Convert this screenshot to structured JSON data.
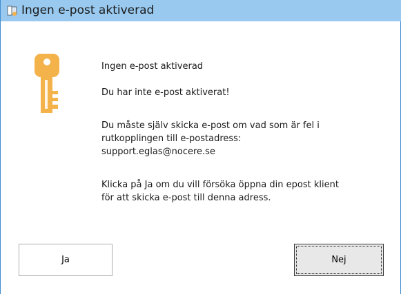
{
  "window": {
    "title": "Ingen e-post aktiverad",
    "title_icon": "app-icon",
    "message_icon": "key-icon"
  },
  "message": {
    "heading": "Ingen e-post aktiverad",
    "line1": "Du har inte e-post aktiverat!",
    "para2_line1": "Du måste själv skicka e-post om vad som är fel i",
    "para2_line2": "rutkopplingen till e-postadress:",
    "para2_line3": "support.eglas@nocere.se",
    "para3_line1": "Klicka på Ja om du vill försöka öppna din epost klient",
    "para3_line2": "för att skicka e-post till denna adress."
  },
  "buttons": {
    "yes_label": "Ja",
    "no_label": "Nej"
  },
  "colors": {
    "titlebar": "#99c9ef",
    "key": "#f4b24a"
  }
}
